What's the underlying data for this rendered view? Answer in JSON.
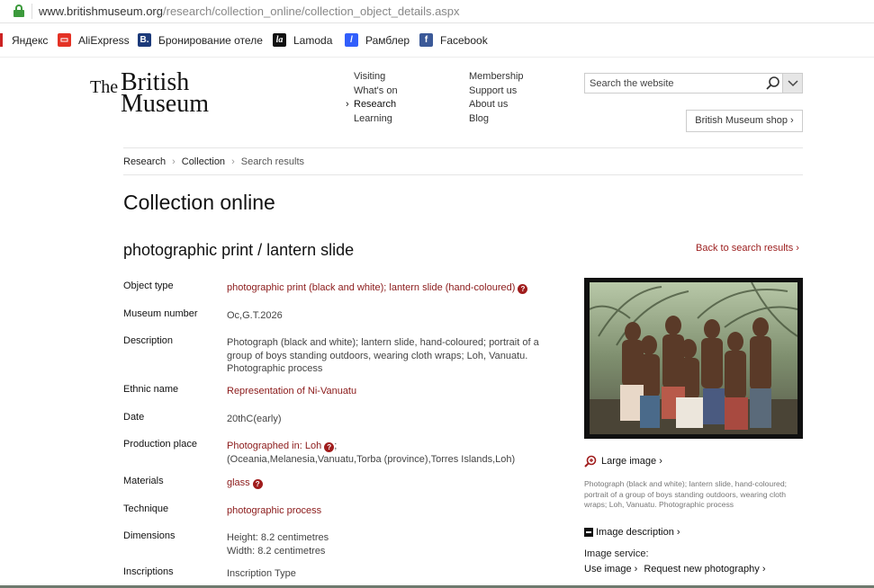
{
  "browser": {
    "url_host": "www.britishmuseum.org",
    "url_path": "/research/collection_online/collection_object_details.aspx",
    "bookmarks": [
      {
        "label": "Яндекс",
        "icon": "yandex-icon",
        "color": "#cc2222"
      },
      {
        "label": "AliExpress",
        "icon": "aliexpress-icon",
        "color": "#e43225"
      },
      {
        "label": "Бронирование отеле",
        "icon": "booking-icon",
        "color": "#1c3a7a"
      },
      {
        "label": "Lamoda",
        "icon": "lamoda-icon",
        "color": "#111111"
      },
      {
        "label": "Рамблер",
        "icon": "rambler-icon",
        "color": "#315efb"
      },
      {
        "label": "Facebook",
        "icon": "facebook-icon",
        "color": "#3b5998"
      }
    ]
  },
  "header": {
    "logo": {
      "the": "The",
      "british": "British",
      "museum": "Museum"
    },
    "nav_col1": [
      "Visiting",
      "What's on",
      "Research",
      "Learning"
    ],
    "nav_col2": [
      "Membership",
      "Support us",
      "About us",
      "Blog"
    ],
    "search_placeholder": "Search the website",
    "shop_label": "British Museum shop ›"
  },
  "breadcrumb": {
    "items": [
      "Research",
      "Collection"
    ],
    "current": "Search results"
  },
  "page_title": "Collection online",
  "object_title": "photographic print / lantern slide",
  "back_link": "Back to search results ›",
  "details": {
    "object_type": {
      "label": "Object type",
      "value": "photographic print (black and white); lantern slide (hand-coloured)"
    },
    "museum_number": {
      "label": "Museum number",
      "value": "Oc,G.T.2026"
    },
    "description": {
      "label": "Description",
      "value": "Photograph (black and white); lantern slide, hand-coloured; portrait of a group of boys standing outdoors, wearing cloth wraps; Loh, Vanuatu. Photographic process"
    },
    "ethnic_name": {
      "label": "Ethnic name",
      "value": "Representation of Ni-Vanuatu"
    },
    "date": {
      "label": "Date",
      "value": "20thC(early)"
    },
    "production_place": {
      "label": "Production place",
      "value": "Photographed in: Loh",
      "extra": "(Oceania,Melanesia,Vanuatu,Torba (province),Torres Islands,Loh)"
    },
    "materials": {
      "label": "Materials",
      "value": "glass"
    },
    "technique": {
      "label": "Technique",
      "value": "photographic process"
    },
    "dimensions": {
      "label": "Dimensions",
      "height": "Height: 8.2 centimetres",
      "width": "Width: 8.2 centimetres"
    },
    "inscriptions": {
      "label": "Inscriptions",
      "value": "Inscription Type"
    }
  },
  "image_panel": {
    "large_image": "Large image ›",
    "caption": "Photograph (black and white); lantern slide, hand-coloured; portrait of a group of boys standing outdoors, wearing cloth wraps; Loh, Vanuatu. Photographic process",
    "image_description": "Image description ›",
    "image_service": "Image service:",
    "use_image": "Use image ›",
    "request_photo": "Request new photography ›"
  },
  "colors": {
    "link": "#8b1a1a",
    "accent_green": "#3c9a3c"
  }
}
